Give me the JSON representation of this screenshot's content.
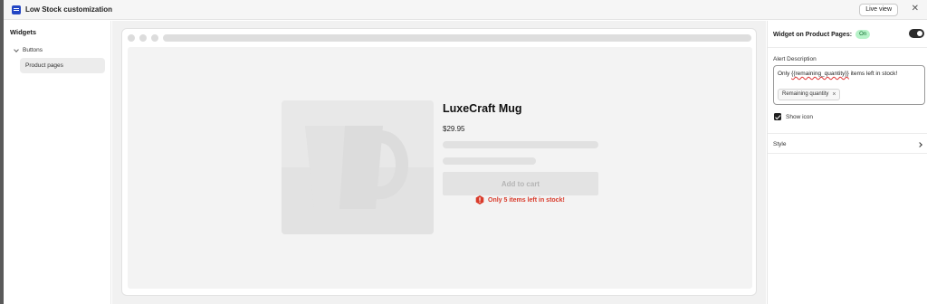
{
  "window": {
    "title": "Low Stock customization",
    "live_view_label": "Live view",
    "close_icon": "close-icon"
  },
  "sidebar": {
    "title": "Widgets",
    "group_label": "Buttons",
    "selected_item": "Product pages"
  },
  "preview": {
    "product_title": "LuxeCraft Mug",
    "price": "$29.95",
    "add_to_cart_label": "Add to cart",
    "alert_text": "Only 5 items left in stock!",
    "alert_color": "#d93b2b",
    "image_icon": "mug-placeholder-icon"
  },
  "settings": {
    "widget_title": "Widget on Product Pages:",
    "status_badge": "On",
    "toggle_on": true,
    "alert_description_label": "Alert Description",
    "alert_description_prefix": "Only ",
    "alert_description_token": "{{remaining_quantity}}",
    "alert_description_suffix": " items left in stock!",
    "chip_label": "Remaining quantity",
    "show_icon_label": "Show icon",
    "show_icon_checked": true,
    "style_label": "Style"
  },
  "colors": {
    "accent": "#2346c4",
    "badge_bg": "#b6f2c8",
    "badge_text": "#0e6a2d"
  }
}
